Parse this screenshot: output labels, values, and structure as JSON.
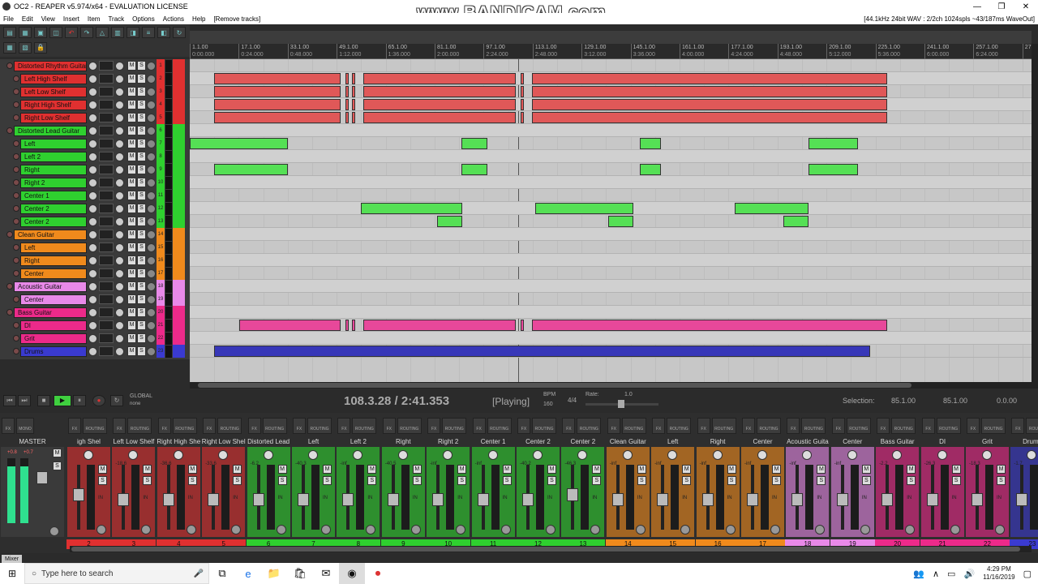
{
  "window": {
    "title": "OC2 - REAPER v5.974/x64 - EVALUATION LICENSE",
    "watermark": "www.BANDICAM.com"
  },
  "menu": {
    "items": [
      "File",
      "Edit",
      "View",
      "Insert",
      "Item",
      "Track",
      "Options",
      "Actions",
      "Help",
      "[Remove tracks]"
    ],
    "status": "[44.1kHz 24bit WAV : 2/2ch 1024spls ~43/187ms WaveOut]"
  },
  "ruler": {
    "marks": [
      {
        "bar": "1.1.00",
        "time": "0:00.000"
      },
      {
        "bar": "17.1.00",
        "time": "0:24.000"
      },
      {
        "bar": "33.1.00",
        "time": "0:48.000"
      },
      {
        "bar": "49.1.00",
        "time": "1:12.000"
      },
      {
        "bar": "65.1.00",
        "time": "1:36.000"
      },
      {
        "bar": "81.1.00",
        "time": "2:00.000"
      },
      {
        "bar": "97.1.00",
        "time": "2:24.000"
      },
      {
        "bar": "113.1.00",
        "time": "2:48.000"
      },
      {
        "bar": "129.1.00",
        "time": "3:12.000"
      },
      {
        "bar": "145.1.00",
        "time": "3:36.000"
      },
      {
        "bar": "161.1.00",
        "time": "4:00.000"
      },
      {
        "bar": "177.1.00",
        "time": "4:24.000"
      },
      {
        "bar": "193.1.00",
        "time": "4:48.000"
      },
      {
        "bar": "209.1.00",
        "time": "5:12.000"
      },
      {
        "bar": "225.1.00",
        "time": "5:36.000"
      },
      {
        "bar": "241.1.00",
        "time": "6:00.000"
      },
      {
        "bar": "257.1.00",
        "time": "6:24.000"
      },
      {
        "bar": "273",
        "time": ""
      }
    ]
  },
  "tracks": [
    {
      "name": "Distorted Rhythm Guitar",
      "folder": true,
      "num": "1",
      "color": "#e03030"
    },
    {
      "name": "Left High Shelf",
      "folder": false,
      "num": "2",
      "color": "#e03030"
    },
    {
      "name": "Left Low Shelf",
      "folder": false,
      "num": "3",
      "color": "#e03030"
    },
    {
      "name": "Right High Shelf",
      "folder": false,
      "num": "4",
      "color": "#e03030"
    },
    {
      "name": "Right Low Shelf",
      "folder": false,
      "num": "5",
      "color": "#e03030"
    },
    {
      "name": "Distorted Lead Guitar",
      "folder": true,
      "num": "6",
      "color": "#2fd02f"
    },
    {
      "name": "Left",
      "folder": false,
      "num": "7",
      "color": "#2fd02f"
    },
    {
      "name": "Left 2",
      "folder": false,
      "num": "8",
      "color": "#2fd02f"
    },
    {
      "name": "Right",
      "folder": false,
      "num": "9",
      "color": "#2fd02f"
    },
    {
      "name": "Right 2",
      "folder": false,
      "num": "10",
      "color": "#2fd02f"
    },
    {
      "name": "Center 1",
      "folder": false,
      "num": "11",
      "color": "#2fd02f"
    },
    {
      "name": "Center 2",
      "folder": false,
      "num": "12",
      "color": "#2fd02f"
    },
    {
      "name": "Center 2",
      "folder": false,
      "num": "13",
      "color": "#2fd02f"
    },
    {
      "name": "Clean Guitar",
      "folder": true,
      "num": "14",
      "color": "#f08a1c"
    },
    {
      "name": "Left",
      "folder": false,
      "num": "15",
      "color": "#f08a1c"
    },
    {
      "name": "Right",
      "folder": false,
      "num": "16",
      "color": "#f08a1c"
    },
    {
      "name": "Center",
      "folder": false,
      "num": "17",
      "color": "#f08a1c"
    },
    {
      "name": "Acoustic Guitar",
      "folder": true,
      "num": "18",
      "color": "#e889e8"
    },
    {
      "name": "Center",
      "folder": false,
      "num": "19",
      "color": "#e889e8"
    },
    {
      "name": "Bass Guitar",
      "folder": true,
      "num": "20",
      "color": "#ec2a8a"
    },
    {
      "name": "DI",
      "folder": false,
      "num": "21",
      "color": "#ec2a8a"
    },
    {
      "name": "Grit",
      "folder": false,
      "num": "22",
      "color": "#ec2a8a"
    },
    {
      "name": "Drums",
      "folder": false,
      "num": "23",
      "color": "#3a3ad0"
    }
  ],
  "button_labels": {
    "mute": "M",
    "solo": "S",
    "fx": "FX",
    "routing": "ROUTING",
    "mono": "MONO",
    "in": "IN"
  },
  "transport": {
    "position": "108.3.28 / 2:41.353",
    "state": "[Playing]",
    "bpm_label": "BPM",
    "bpm": "160",
    "timesig": "4/4",
    "rate_label": "Rate:",
    "rate": "1.0",
    "global_label": "GLOBAL",
    "global_sub": "none",
    "selection_label": "Selection:",
    "selection_start": "85.1.00",
    "selection_end": "85.1.00",
    "selection_length": "0.0.00"
  },
  "mixer": {
    "tab_label": "Mixer",
    "master_label": "MASTER",
    "master_levels": [
      "+0.8",
      "+0.7"
    ],
    "strips": [
      {
        "name": "igh Shel",
        "num": "2",
        "color": "#e03030",
        "level": "",
        "fader": 0.55
      },
      {
        "name": "Left Low Shelf",
        "num": "3",
        "color": "#e03030",
        "level": "-18.6",
        "fader": 0.45
      },
      {
        "name": "Right High She",
        "num": "4",
        "color": "#e03030",
        "level": "-36.6",
        "fader": 0.45
      },
      {
        "name": "Right Low Shel",
        "num": "5",
        "color": "#e03030",
        "level": "-33.6",
        "fader": 0.45
      },
      {
        "name": "Distorted Lead",
        "num": "6",
        "color": "#2fd02f",
        "level": "-6.2",
        "fader": 0.45
      },
      {
        "name": "Left",
        "num": "7",
        "color": "#2fd02f",
        "level": "-40.3",
        "fader": 0.45
      },
      {
        "name": "Left 2",
        "num": "8",
        "color": "#2fd02f",
        "level": "-inf",
        "fader": 0.45
      },
      {
        "name": "Right",
        "num": "9",
        "color": "#2fd02f",
        "level": "-40.5",
        "fader": 0.45
      },
      {
        "name": "Right 2",
        "num": "10",
        "color": "#2fd02f",
        "level": "-inf",
        "fader": 0.45
      },
      {
        "name": "Center 1",
        "num": "11",
        "color": "#2fd02f",
        "level": "-inf",
        "fader": 0.45
      },
      {
        "name": "Center 2",
        "num": "12",
        "color": "#2fd02f",
        "level": "-40.2",
        "fader": 0.45
      },
      {
        "name": "Center 2",
        "num": "13",
        "color": "#2fd02f",
        "level": "-46.3",
        "fader": 0.55
      },
      {
        "name": "Clean Guitar",
        "num": "14",
        "color": "#f08a1c",
        "level": "-inf",
        "fader": 0.45
      },
      {
        "name": "Left",
        "num": "15",
        "color": "#f08a1c",
        "level": "-inf",
        "fader": 0.45
      },
      {
        "name": "Right",
        "num": "16",
        "color": "#f08a1c",
        "level": "-inf",
        "fader": 0.45
      },
      {
        "name": "Center",
        "num": "17",
        "color": "#f08a1c",
        "level": "-inf",
        "fader": 0.45
      },
      {
        "name": "Acoustic Guita",
        "num": "18",
        "color": "#e889e8",
        "level": "-inf",
        "fader": 0.45
      },
      {
        "name": "Center",
        "num": "19",
        "color": "#e889e8",
        "level": "-inf",
        "fader": 0.45
      },
      {
        "name": "Bass Guitar",
        "num": "20",
        "color": "#ec2a8a",
        "level": "-2.2",
        "fader": 0.45
      },
      {
        "name": "DI",
        "num": "21",
        "color": "#ec2a8a",
        "level": "-26.3",
        "fader": 0.45
      },
      {
        "name": "Grit",
        "num": "22",
        "color": "#ec2a8a",
        "level": "-18.3",
        "fader": 0.45
      },
      {
        "name": "Drums",
        "num": "23",
        "color": "#3a3ad0",
        "level": "-1.7",
        "fader": 0.45
      }
    ]
  },
  "taskbar": {
    "search_placeholder": "Type here to search",
    "time": "4:29 PM",
    "date": "11/16/2019"
  }
}
